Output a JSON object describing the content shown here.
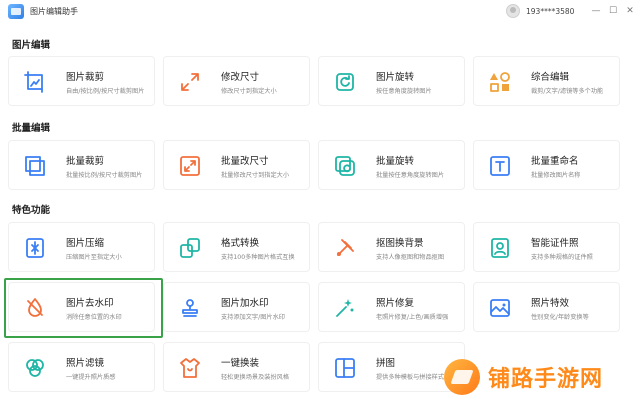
{
  "app": {
    "title": "图片编辑助手",
    "user": "193****3580"
  },
  "window_controls": {
    "minimize": "—",
    "maximize": "☐",
    "close": "✕"
  },
  "sections": [
    {
      "title": "图片编辑",
      "cards": [
        {
          "title": "图片裁剪",
          "desc": "自由/按比例/按尺寸裁剪图片",
          "icon": "crop-icon",
          "color": "#3b7ff5"
        },
        {
          "title": "修改尺寸",
          "desc": "修改尺寸到指定大小",
          "icon": "resize-icon",
          "color": "#f2703c"
        },
        {
          "title": "图片旋转",
          "desc": "按任意角度旋转图片",
          "icon": "rotate-icon",
          "color": "#1fb6a6"
        },
        {
          "title": "综合编辑",
          "desc": "裁剪/文字/滤镜等多个功能",
          "icon": "edit-shapes-icon",
          "color": "#f0a23b"
        }
      ]
    },
    {
      "title": "批量编辑",
      "cards": [
        {
          "title": "批量裁剪",
          "desc": "批量按比例/按尺寸裁剪图片",
          "icon": "batch-crop-icon",
          "color": "#3b7ff5"
        },
        {
          "title": "批量改尺寸",
          "desc": "批量修改尺寸到指定大小",
          "icon": "batch-resize-icon",
          "color": "#f2703c"
        },
        {
          "title": "批量旋转",
          "desc": "批量按任意角度旋转图片",
          "icon": "batch-rotate-icon",
          "color": "#1fb6a6"
        },
        {
          "title": "批量重命名",
          "desc": "批量修改图片名称",
          "icon": "batch-rename-icon",
          "color": "#3b7ff5"
        }
      ]
    },
    {
      "title": "特色功能",
      "cards": [
        {
          "title": "图片压缩",
          "desc": "压缩图片至指定大小",
          "icon": "compress-icon",
          "color": "#3b7ff5"
        },
        {
          "title": "格式转换",
          "desc": "支持100多种图片格式互换",
          "icon": "convert-icon",
          "color": "#1fb6a6"
        },
        {
          "title": "抠图换背景",
          "desc": "支持人像抠图和物品抠图",
          "icon": "cutout-icon",
          "color": "#f2703c"
        },
        {
          "title": "智能证件照",
          "desc": "支持多种规格的证件照",
          "icon": "id-photo-icon",
          "color": "#1fb6a6"
        },
        {
          "title": "图片去水印",
          "desc": "消除任意位置的水印",
          "icon": "remove-watermark-icon",
          "color": "#f2703c"
        },
        {
          "title": "图片加水印",
          "desc": "支持添加文字/图片水印",
          "icon": "add-watermark-icon",
          "color": "#3b7ff5"
        },
        {
          "title": "照片修复",
          "desc": "老照片修复/上色/画质增强",
          "icon": "repair-icon",
          "color": "#1fb6a6"
        },
        {
          "title": "照片特效",
          "desc": "性别变化/年龄变换等",
          "icon": "effects-icon",
          "color": "#3b7ff5"
        },
        {
          "title": "照片滤镜",
          "desc": "一键提升照片质感",
          "icon": "filter-icon",
          "color": "#1fb6a6"
        },
        {
          "title": "一键换装",
          "desc": "轻松更换场景及装扮风格",
          "icon": "outfit-icon",
          "color": "#f2703c"
        },
        {
          "title": "拼图",
          "desc": "提供多种模板与拼接样式",
          "icon": "collage-icon",
          "color": "#3b7ff5"
        }
      ]
    }
  ],
  "watermark": {
    "text": "铺路手游网"
  }
}
